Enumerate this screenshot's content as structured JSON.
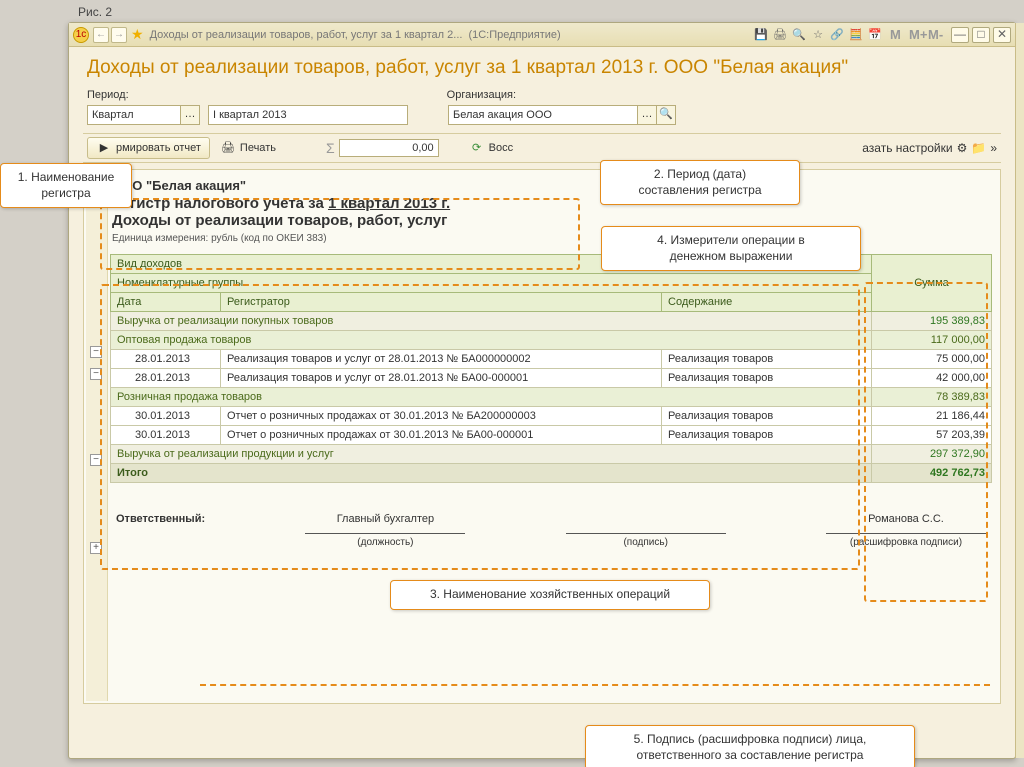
{
  "fig_label": "Рис. 2",
  "window": {
    "title": "Доходы от реализации товаров, работ, услуг за 1 квартал 2...",
    "title_suffix": "(1С:Предприятие)",
    "m1": "M",
    "m2": "M+",
    "m3": "M-"
  },
  "main_title": "Доходы от реализации товаров, работ, услуг за 1 квартал 2013 г. ООО \"Белая акация\"",
  "filters": {
    "period_label": "Период:",
    "org_label": "Организация:",
    "period_type": "Квартал",
    "period_value": "I квартал 2013",
    "org_value": "Белая акация ООО"
  },
  "toolbar": {
    "form_report": "рмировать отчет",
    "print": "Печать",
    "sum_sign": "Σ",
    "sum_value": "0,00",
    "restore": "Восс",
    "show_settings": "азать настройки",
    "more": "»"
  },
  "report_header": {
    "org": "ООО \"Белая акация\"",
    "line1a": "Регистр налогового учета за ",
    "line1b": "1 квартал 2013 г.",
    "line2": "Доходы от реализации товаров, работ, услуг",
    "unit": "Единица измерения:    рубль (код по ОКЕИ 383)"
  },
  "table": {
    "h_type": "Вид доходов",
    "h_group": "Номенклатурные группы",
    "h_date": "Дата",
    "h_reg": "Регистратор",
    "h_content": "Содержание",
    "h_sum": "Сумма",
    "rows": [
      {
        "cls": "lvl0",
        "text": "Выручка от реализации покупных товаров",
        "amt": "195 389,83"
      },
      {
        "cls": "lvl1",
        "text": "Оптовая продажа товаров",
        "amt": "117 000,00"
      },
      {
        "cls": "lvl2",
        "date": "28.01.2013",
        "reg": "Реализация товаров и услуг от 28.01.2013 № БА000000002",
        "cont": "Реализация товаров",
        "amt": "75 000,00"
      },
      {
        "cls": "lvl2",
        "date": "28.01.2013",
        "reg": "Реализация товаров и услуг от 28.01.2013 № БА00-000001",
        "cont": "Реализация товаров",
        "amt": "42 000,00"
      },
      {
        "cls": "lvl1",
        "text": "Розничная продажа товаров",
        "amt": "78 389,83"
      },
      {
        "cls": "lvl2",
        "date": "30.01.2013",
        "reg": "Отчет о розничных продажах от 30.01.2013 № БА200000003",
        "cont": "Реализация товаров",
        "amt": "21 186,44"
      },
      {
        "cls": "lvl2",
        "date": "30.01.2013",
        "reg": "Отчет о розничных продажах от 30.01.2013 № БА00-000001",
        "cont": "Реализация товаров",
        "amt": "57 203,39"
      },
      {
        "cls": "lvl0",
        "text": "Выручка от реализации продукции и услуг",
        "amt": "297 372,90"
      }
    ],
    "total_label": "Итого",
    "total_amt": "492 762,73"
  },
  "signature": {
    "resp": "Ответственный:",
    "pos": "Главный бухгалтер",
    "pos_sub": "(должность)",
    "sign_sub": "(подпись)",
    "name": "Романова С.С.",
    "name_sub": "(расшифровка подписи)"
  },
  "callouts": {
    "c1": "1. Наименование регистра",
    "c2a": "2. Период (дата)",
    "c2b": "составления регистра",
    "c3": "3. Наименование хозяйственных операций",
    "c4a": "4. Измерители операции в",
    "c4b": "денежном выражении",
    "c5a": "5. Подпись (расшифровка подписи) лица,",
    "c5b": "ответственного за составление регистра"
  }
}
